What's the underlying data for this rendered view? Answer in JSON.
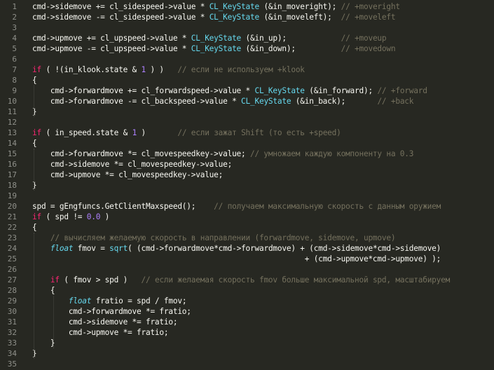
{
  "editor": {
    "theme_colors": {
      "background": "#272822",
      "plain": "#f8f8f2",
      "keyword": "#f92672",
      "function": "#66d9ef",
      "number": "#ae81ff",
      "comment": "#75715e",
      "line_number": "#8f908a"
    },
    "lines": [
      {
        "n": "1",
        "tokens": [
          [
            "p",
            "cmd->sidemove += cl_sidespeed->value * "
          ],
          [
            "f",
            "CL_KeyState"
          ],
          [
            "p",
            " (&in_moveright); "
          ],
          [
            "c",
            "// +moveright"
          ]
        ]
      },
      {
        "n": "2",
        "tokens": [
          [
            "p",
            "cmd->sidemove -= cl_sidespeed->value * "
          ],
          [
            "f",
            "CL_KeyState"
          ],
          [
            "p",
            " (&in_moveleft);  "
          ],
          [
            "c",
            "// +moveleft"
          ]
        ]
      },
      {
        "n": "3",
        "tokens": []
      },
      {
        "n": "4",
        "tokens": [
          [
            "p",
            "cmd->upmove += cl_upspeed->value * "
          ],
          [
            "f",
            "CL_KeyState"
          ],
          [
            "p",
            " (&in_up);            "
          ],
          [
            "c",
            "// +moveup"
          ]
        ]
      },
      {
        "n": "5",
        "tokens": [
          [
            "p",
            "cmd->upmove -= cl_upspeed->value * "
          ],
          [
            "f",
            "CL_KeyState"
          ],
          [
            "p",
            " (&in_down);          "
          ],
          [
            "c",
            "// +movedown"
          ]
        ]
      },
      {
        "n": "6",
        "tokens": []
      },
      {
        "n": "7",
        "tokens": [
          [
            "k",
            "if"
          ],
          [
            "p",
            " ( !(in_klook.state & "
          ],
          [
            "n",
            "1"
          ],
          [
            "p",
            " ) )   "
          ],
          [
            "c",
            "// если не используем +klook"
          ]
        ]
      },
      {
        "n": "8",
        "tokens": [
          [
            "p",
            "{"
          ]
        ]
      },
      {
        "n": "9",
        "tokens": [
          [
            "p",
            "    cmd->forwardmove += cl_forwardspeed->value * "
          ],
          [
            "f",
            "CL_KeyState"
          ],
          [
            "p",
            " (&in_forward); "
          ],
          [
            "c",
            "// +forward"
          ]
        ]
      },
      {
        "n": "10",
        "tokens": [
          [
            "p",
            "    cmd->forwardmove -= cl_backspeed->value * "
          ],
          [
            "f",
            "CL_KeyState"
          ],
          [
            "p",
            " (&in_back);       "
          ],
          [
            "c",
            "// +back"
          ]
        ]
      },
      {
        "n": "11",
        "tokens": [
          [
            "p",
            "}"
          ]
        ]
      },
      {
        "n": "12",
        "tokens": []
      },
      {
        "n": "13",
        "tokens": [
          [
            "k",
            "if"
          ],
          [
            "p",
            " ( in_speed.state & "
          ],
          [
            "n",
            "1"
          ],
          [
            "p",
            " )       "
          ],
          [
            "c",
            "// если зажат Shift (то есть +speed)"
          ]
        ]
      },
      {
        "n": "14",
        "tokens": [
          [
            "p",
            "{"
          ]
        ]
      },
      {
        "n": "15",
        "tokens": [
          [
            "p",
            "    cmd->forwardmove *= cl_movespeedkey->value; "
          ],
          [
            "c",
            "// умножаем каждую компоненту на 0.3"
          ]
        ]
      },
      {
        "n": "16",
        "tokens": [
          [
            "p",
            "    cmd->sidemove *= cl_movespeedkey->value;"
          ]
        ]
      },
      {
        "n": "17",
        "tokens": [
          [
            "p",
            "    cmd->upmove *= cl_movespeedkey->value;"
          ]
        ]
      },
      {
        "n": "18",
        "tokens": [
          [
            "p",
            "}"
          ]
        ]
      },
      {
        "n": "19",
        "tokens": []
      },
      {
        "n": "20",
        "tokens": [
          [
            "p",
            "spd = gEngfuncs.GetClientMaxspeed();    "
          ],
          [
            "c",
            "// получаем максимальную скорость с данным оружием"
          ]
        ]
      },
      {
        "n": "21",
        "tokens": [
          [
            "k",
            "if"
          ],
          [
            "p",
            " ( spd != "
          ],
          [
            "n",
            "0.0"
          ],
          [
            "p",
            " )"
          ]
        ]
      },
      {
        "n": "22",
        "tokens": [
          [
            "p",
            "{"
          ]
        ]
      },
      {
        "n": "23",
        "tokens": [
          [
            "p",
            "    "
          ],
          [
            "c",
            "// вычисляем желаемую скорость в направлении (forwardmove, sidemove, upmove)"
          ]
        ]
      },
      {
        "n": "24",
        "tokens": [
          [
            "p",
            "    "
          ],
          [
            "fi",
            "float"
          ],
          [
            "p",
            " fmov = "
          ],
          [
            "f",
            "sqrt"
          ],
          [
            "p",
            "( (cmd->forwardmove*cmd->forwardmove) + (cmd->sidemove*cmd->sidemove)"
          ]
        ]
      },
      {
        "n": "25",
        "tokens": [
          [
            "p",
            "                                                            + (cmd->upmove*cmd->upmove) );"
          ]
        ]
      },
      {
        "n": "26",
        "tokens": []
      },
      {
        "n": "27",
        "tokens": [
          [
            "p",
            "    "
          ],
          [
            "k",
            "if"
          ],
          [
            "p",
            " ( fmov > spd )   "
          ],
          [
            "c",
            "// если желаемая скорость fmov больше максимальной spd, масштабируем"
          ]
        ]
      },
      {
        "n": "28",
        "tokens": [
          [
            "p",
            "    {"
          ]
        ]
      },
      {
        "n": "29",
        "tokens": [
          [
            "p",
            "        "
          ],
          [
            "fi",
            "float"
          ],
          [
            "p",
            " fratio = spd / fmov;"
          ]
        ]
      },
      {
        "n": "30",
        "tokens": [
          [
            "p",
            "        cmd->forwardmove *= fratio;"
          ]
        ]
      },
      {
        "n": "31",
        "tokens": [
          [
            "p",
            "        cmd->sidemove *= fratio;"
          ]
        ]
      },
      {
        "n": "32",
        "tokens": [
          [
            "p",
            "        cmd->upmove *= fratio;"
          ]
        ]
      },
      {
        "n": "33",
        "tokens": [
          [
            "p",
            "    }"
          ]
        ]
      },
      {
        "n": "34",
        "tokens": [
          [
            "p",
            "}"
          ]
        ]
      },
      {
        "n": "35",
        "tokens": []
      }
    ]
  }
}
